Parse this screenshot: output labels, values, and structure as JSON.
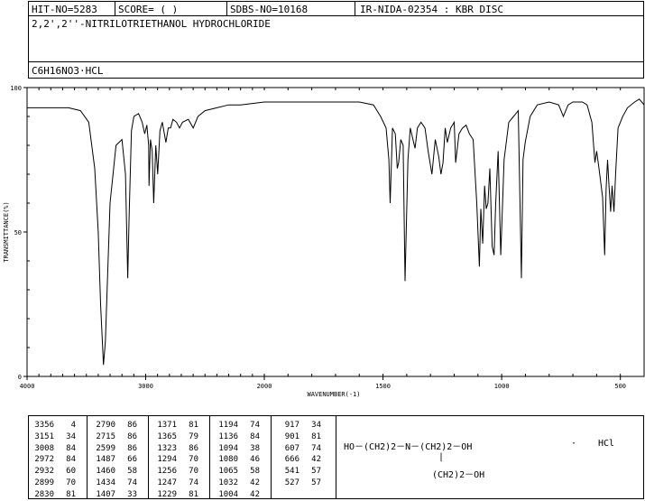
{
  "header": {
    "hit_no": "HIT-NO=5283",
    "score": "SCORE=  (  )",
    "sdbs_no": "SDBS-NO=10168",
    "ir_info": "IR-NIDA-02354 : KBR DISC"
  },
  "compound": {
    "name": "2,2',2''-NITRILOTRIETHANOL HYDROCHLORIDE",
    "formula": "C6H16NO3·HCL"
  },
  "chart_data": {
    "type": "line",
    "title": "",
    "xlabel": "WAVENUMBER(-1)",
    "ylabel": "TRANSMITTANCE(%)",
    "xlim": [
      4000,
      400
    ],
    "ylim": [
      0,
      100
    ],
    "x_ticks": [
      "4000",
      "3000",
      "2000",
      "1500",
      "1000",
      "500"
    ],
    "y_ticks": [
      "100",
      "50",
      "0"
    ],
    "grid": false,
    "series": [
      {
        "x": [
          4000,
          3800,
          3650,
          3550,
          3480,
          3430,
          3400,
          3380,
          3356,
          3340,
          3300,
          3250,
          3200,
          3170,
          3151,
          3140,
          3120,
          3100,
          3060,
          3030,
          3008,
          2990,
          2975,
          2972,
          2960,
          2945,
          2932,
          2915,
          2899,
          2880,
          2860,
          2830,
          2810,
          2790,
          2770,
          2740,
          2715,
          2690,
          2640,
          2599,
          2560,
          2500,
          2400,
          2300,
          2200,
          2100,
          2000,
          1900,
          1800,
          1700,
          1600,
          1540,
          1510,
          1487,
          1475,
          1470,
          1460,
          1448,
          1440,
          1434,
          1425,
          1415,
          1407,
          1395,
          1385,
          1371,
          1365,
          1355,
          1340,
          1323,
          1310,
          1294,
          1280,
          1265,
          1256,
          1247,
          1238,
          1229,
          1215,
          1200,
          1194,
          1180,
          1165,
          1150,
          1136,
          1120,
          1105,
          1094,
          1088,
          1080,
          1072,
          1065,
          1058,
          1050,
          1040,
          1032,
          1025,
          1015,
          1004,
          990,
          970,
          950,
          930,
          917,
          910,
          901,
          880,
          850,
          800,
          760,
          740,
          720,
          700,
          680,
          660,
          640,
          620,
          607,
          600,
          590,
          575,
          566,
          560,
          554,
          548,
          541,
          535,
          527,
          520,
          510,
          490,
          470,
          440,
          420,
          400
        ],
        "y": [
          93,
          93,
          93,
          92,
          88,
          72,
          50,
          25,
          4,
          12,
          60,
          80,
          82,
          70,
          34,
          55,
          85,
          90,
          91,
          88,
          84,
          87,
          80,
          66,
          82,
          78,
          60,
          80,
          70,
          85,
          88,
          81,
          86,
          86,
          89,
          88,
          86,
          88,
          89,
          86,
          90,
          92,
          93,
          94,
          94,
          94.5,
          95,
          95,
          95,
          95,
          95,
          94,
          90,
          86,
          75,
          60,
          86,
          84,
          72,
          74,
          82,
          80,
          33,
          75,
          86,
          81,
          79,
          86,
          88,
          86,
          78,
          70,
          82,
          76,
          70,
          74,
          86,
          81,
          86,
          88,
          74,
          84,
          86,
          87,
          84,
          82,
          60,
          38,
          58,
          46,
          66,
          58,
          60,
          72,
          45,
          42,
          60,
          78,
          42,
          75,
          88,
          90,
          92,
          34,
          75,
          81,
          90,
          94,
          95,
          94,
          90,
          94,
          95,
          95,
          95,
          94,
          88,
          74,
          78,
          72,
          62,
          42,
          65,
          75,
          66,
          57,
          66,
          57,
          70,
          86,
          90,
          93,
          95,
          96,
          94
        ]
      }
    ]
  },
  "peak_table": {
    "columns": [
      [
        [
          "3356",
          "4"
        ],
        [
          "3151",
          "34"
        ],
        [
          "3008",
          "84"
        ],
        [
          "2972",
          "84"
        ],
        [
          "2932",
          "60"
        ],
        [
          "2899",
          "70"
        ],
        [
          "2830",
          "81"
        ]
      ],
      [
        [
          "2790",
          "86"
        ],
        [
          "2715",
          "86"
        ],
        [
          "2599",
          "86"
        ],
        [
          "1487",
          "66"
        ],
        [
          "1460",
          "58"
        ],
        [
          "1434",
          "74"
        ],
        [
          "1407",
          "33"
        ]
      ],
      [
        [
          "1371",
          "81"
        ],
        [
          "1365",
          "79"
        ],
        [
          "1323",
          "86"
        ],
        [
          "1294",
          "70"
        ],
        [
          "1256",
          "70"
        ],
        [
          "1247",
          "74"
        ],
        [
          "1229",
          "81"
        ]
      ],
      [
        [
          "1194",
          "74"
        ],
        [
          "1136",
          "84"
        ],
        [
          "1094",
          "38"
        ],
        [
          "1080",
          "46"
        ],
        [
          "1065",
          "58"
        ],
        [
          "1032",
          "42"
        ],
        [
          "1004",
          "42"
        ]
      ],
      [
        [
          "917",
          "34"
        ],
        [
          "901",
          "81"
        ],
        [
          "607",
          "74"
        ],
        [
          "666",
          "42"
        ],
        [
          "541",
          "57"
        ],
        [
          "527",
          "57"
        ]
      ]
    ]
  },
  "structure": {
    "line1": "HO－(CH2)2－N－(CH2)2－OH",
    "line2": "(CH2)2－OH",
    "dot": "·",
    "acid": "HCl"
  }
}
